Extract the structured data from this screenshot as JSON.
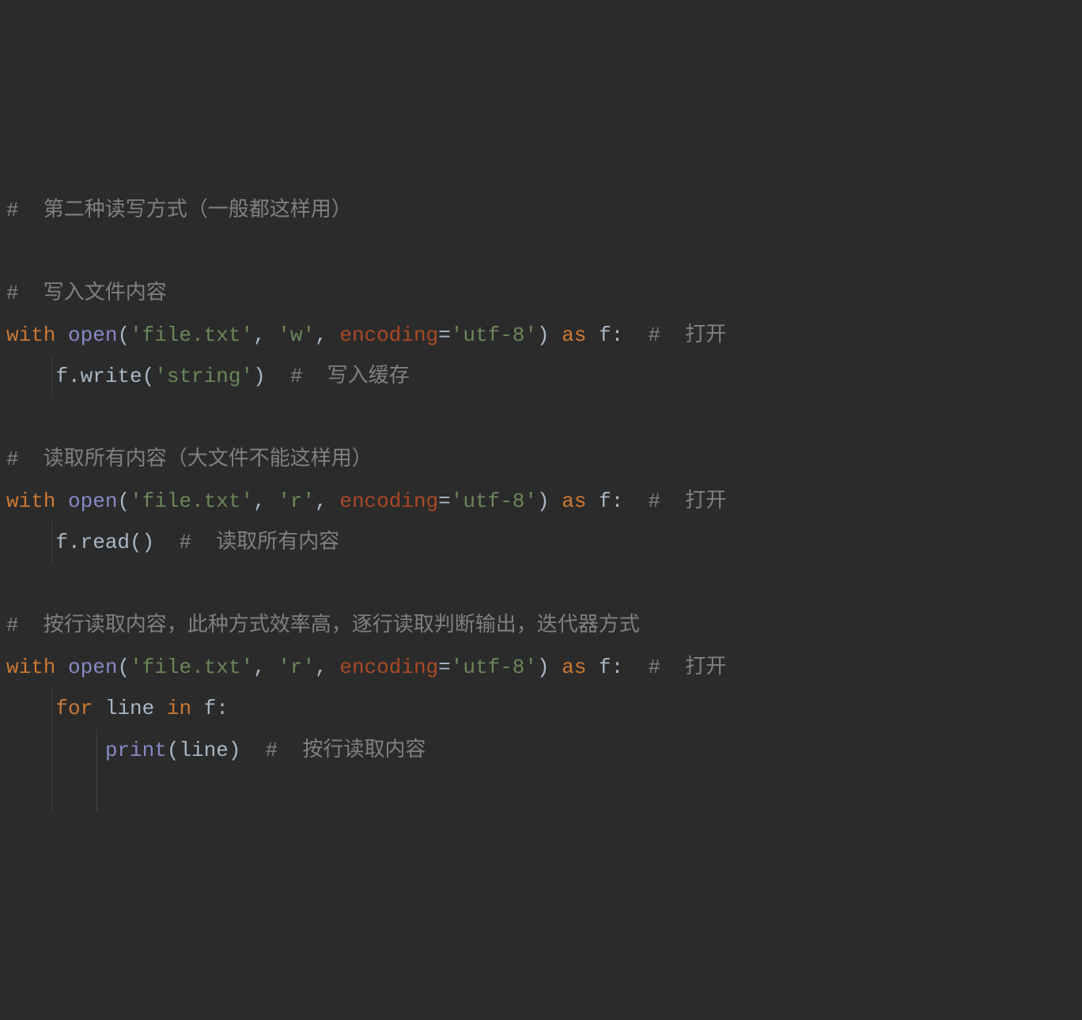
{
  "code": {
    "lines": [
      {
        "tokens": [
          {
            "text": "#  第二种读写方式（一般都这样用）",
            "cls": "comment"
          }
        ]
      },
      {
        "tokens": []
      },
      {
        "tokens": [
          {
            "text": "#  写入文件内容",
            "cls": "comment"
          }
        ]
      },
      {
        "tokens": [
          {
            "text": "with",
            "cls": "keyword"
          },
          {
            "text": " ",
            "cls": "punct"
          },
          {
            "text": "open",
            "cls": "builtin"
          },
          {
            "text": "(",
            "cls": "punct"
          },
          {
            "text": "'file.txt'",
            "cls": "string"
          },
          {
            "text": ", ",
            "cls": "punct"
          },
          {
            "text": "'w'",
            "cls": "string"
          },
          {
            "text": ", ",
            "cls": "punct"
          },
          {
            "text": "encoding",
            "cls": "param"
          },
          {
            "text": "=",
            "cls": "punct"
          },
          {
            "text": "'utf-8'",
            "cls": "string"
          },
          {
            "text": ") ",
            "cls": "punct"
          },
          {
            "text": "as",
            "cls": "keyword"
          },
          {
            "text": " f:  ",
            "cls": "punct"
          },
          {
            "text": "#  打开",
            "cls": "comment"
          }
        ]
      },
      {
        "indent": 1,
        "tokens": [
          {
            "text": "    f.write(",
            "cls": "punct"
          },
          {
            "text": "'string'",
            "cls": "string"
          },
          {
            "text": ")  ",
            "cls": "punct"
          },
          {
            "text": "#  写入缓存",
            "cls": "comment"
          }
        ]
      },
      {
        "tokens": []
      },
      {
        "tokens": [
          {
            "text": "#  读取所有内容（大文件不能这样用）",
            "cls": "comment"
          }
        ]
      },
      {
        "tokens": [
          {
            "text": "with",
            "cls": "keyword"
          },
          {
            "text": " ",
            "cls": "punct"
          },
          {
            "text": "open",
            "cls": "builtin"
          },
          {
            "text": "(",
            "cls": "punct"
          },
          {
            "text": "'file.txt'",
            "cls": "string"
          },
          {
            "text": ", ",
            "cls": "punct"
          },
          {
            "text": "'r'",
            "cls": "string"
          },
          {
            "text": ", ",
            "cls": "punct"
          },
          {
            "text": "encoding",
            "cls": "param"
          },
          {
            "text": "=",
            "cls": "punct"
          },
          {
            "text": "'utf-8'",
            "cls": "string"
          },
          {
            "text": ") ",
            "cls": "punct"
          },
          {
            "text": "as",
            "cls": "keyword"
          },
          {
            "text": " f:  ",
            "cls": "punct"
          },
          {
            "text": "#  打开",
            "cls": "comment"
          }
        ]
      },
      {
        "indent": 1,
        "tokens": [
          {
            "text": "    f.read()  ",
            "cls": "punct"
          },
          {
            "text": "#  读取所有内容",
            "cls": "comment"
          }
        ]
      },
      {
        "tokens": []
      },
      {
        "tokens": [
          {
            "text": "#  按行读取内容，此种方式效率高，逐行读取判断输出，迭代器方式",
            "cls": "comment"
          }
        ]
      },
      {
        "tokens": [
          {
            "text": "with",
            "cls": "keyword"
          },
          {
            "text": " ",
            "cls": "punct"
          },
          {
            "text": "open",
            "cls": "builtin"
          },
          {
            "text": "(",
            "cls": "punct"
          },
          {
            "text": "'file.txt'",
            "cls": "string"
          },
          {
            "text": ", ",
            "cls": "punct"
          },
          {
            "text": "'r'",
            "cls": "string"
          },
          {
            "text": ", ",
            "cls": "punct"
          },
          {
            "text": "encoding",
            "cls": "param"
          },
          {
            "text": "=",
            "cls": "punct"
          },
          {
            "text": "'utf-8'",
            "cls": "string"
          },
          {
            "text": ") ",
            "cls": "punct"
          },
          {
            "text": "as",
            "cls": "keyword"
          },
          {
            "text": " f:  ",
            "cls": "punct"
          },
          {
            "text": "#  打开",
            "cls": "comment"
          }
        ]
      },
      {
        "indent": 1,
        "tokens": [
          {
            "text": "    ",
            "cls": "punct"
          },
          {
            "text": "for",
            "cls": "keyword"
          },
          {
            "text": " line ",
            "cls": "punct"
          },
          {
            "text": "in",
            "cls": "keyword"
          },
          {
            "text": " f:",
            "cls": "punct"
          }
        ]
      },
      {
        "indent": 2,
        "tokens": [
          {
            "text": "        ",
            "cls": "punct"
          },
          {
            "text": "print",
            "cls": "builtin"
          },
          {
            "text": "(line)  ",
            "cls": "punct"
          },
          {
            "text": "#  按行读取内容",
            "cls": "comment"
          }
        ]
      },
      {
        "indent": 2,
        "tokens": [
          {
            "text": "        ",
            "cls": "punct"
          }
        ]
      }
    ]
  }
}
